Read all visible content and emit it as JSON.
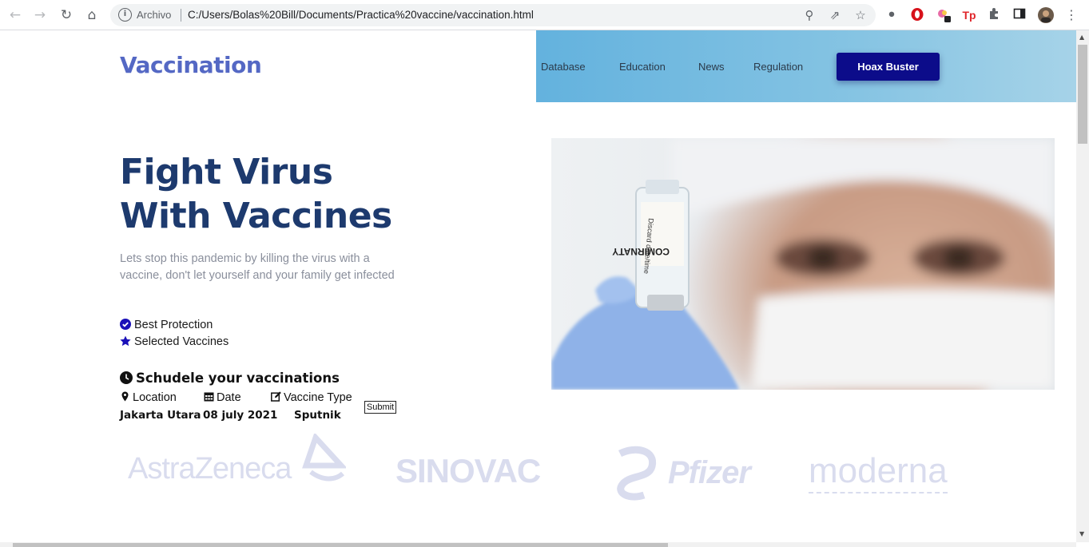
{
  "browser": {
    "address_label": "Archivo",
    "url": "C:/Users/Bolas%20Bill/Documents/Practica%20vaccine/vaccination.html"
  },
  "site": {
    "brand": "Vaccination",
    "nav": [
      "Database",
      "Education",
      "News",
      "Regulation"
    ],
    "cta": "Hoax Buster"
  },
  "hero": {
    "title_line1": "Fight Virus",
    "title_line2": "With Vaccines",
    "description": "Lets stop this pandemic by killing the virus with a vaccine, don't let yourself and your family get infected",
    "features": [
      "Best Protection",
      "Selected Vaccines"
    ],
    "vial_label": "COMIRNATY"
  },
  "schedule": {
    "title": "Schudele your vaccinations",
    "labels": {
      "location": "Location",
      "date": "Date",
      "type": "Vaccine Type"
    },
    "values": {
      "location": "Jakarta Utara",
      "date": "08 july 2021",
      "type": "Sputnik"
    },
    "submit": "Submit"
  },
  "partners": [
    "AstraZeneca",
    "SINOVAC",
    "Pfizer",
    "moderna"
  ],
  "colors": {
    "brand": "#5468c4",
    "cta": "#0c0c8a",
    "title": "#1d3a6e",
    "nav_gradient_start": "#63b2de"
  }
}
